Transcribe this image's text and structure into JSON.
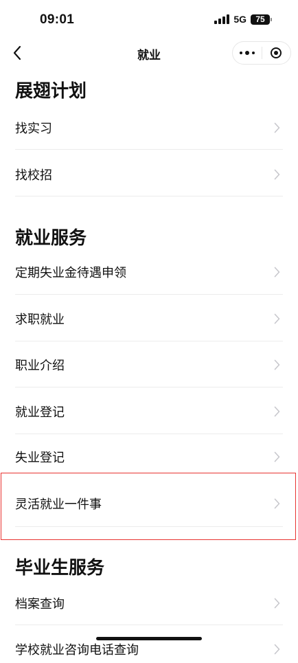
{
  "status_bar": {
    "time": "09:01",
    "network": "5G",
    "battery": "75"
  },
  "nav": {
    "title": "就业"
  },
  "sections": [
    {
      "title": "展翅计划",
      "items": [
        "找实习",
        "找校招"
      ]
    },
    {
      "title": "就业服务",
      "items": [
        "定期失业金待遇申领",
        "求职就业",
        "职业介绍",
        "就业登记",
        "失业登记",
        "灵活就业一件事"
      ]
    },
    {
      "title": "毕业生服务",
      "items": [
        "档案查询",
        "学校就业咨询电话查询"
      ]
    }
  ],
  "colors": {
    "highlight_border": "#e8322f",
    "chevron": "#c7c7cc",
    "divider": "#ececec"
  }
}
